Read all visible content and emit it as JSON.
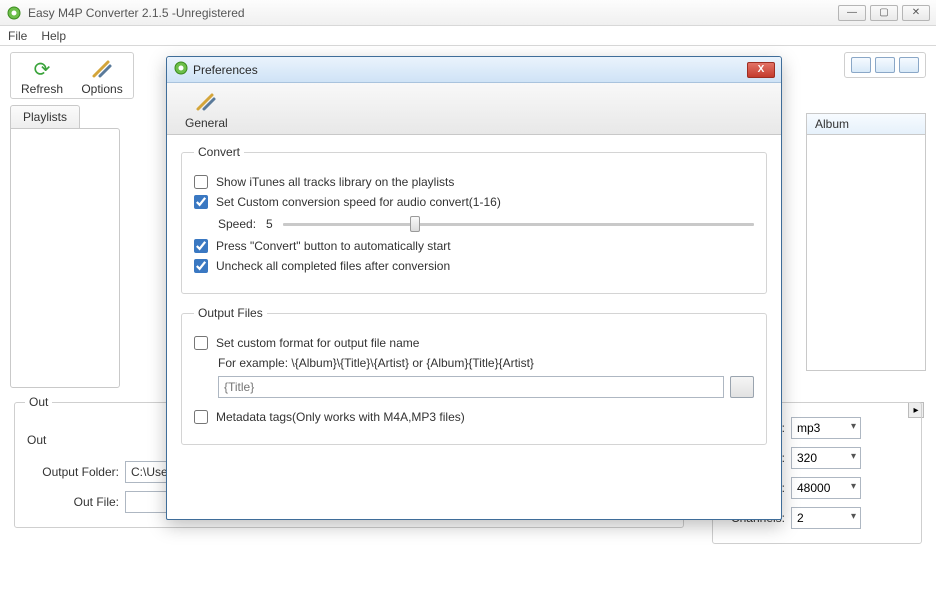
{
  "window": {
    "title": "Easy M4P Converter 2.1.5 -Unregistered"
  },
  "menu": {
    "file": "File",
    "help": "Help"
  },
  "toolbar": {
    "refresh": "Refresh",
    "options": "Options"
  },
  "playlists_tab": "Playlists",
  "list_column_album": "Album",
  "output_section": {
    "legend_prefix": "Out",
    "line2_prefix": "Out",
    "folder_label": "Output Folder:",
    "folder_value": "C:\\Users\\Ontecnia\\Music\\Easy M4P Converter",
    "outfile_label": "Out File:",
    "browse": "..."
  },
  "right_options": {
    "codec_label": "ec:",
    "codec_value": "mp3",
    "bitrate_label": "s):",
    "bitrate_value": "320",
    "samplerate_label_suffix": "(hz):",
    "samplerate_value": "48000",
    "channels_label": "Channels:",
    "channels_value": "2"
  },
  "dialog": {
    "title": "Preferences",
    "tab_general": "General",
    "groups": {
      "convert": {
        "legend": "Convert",
        "show_itunes": "Show iTunes all tracks library on the playlists",
        "custom_speed": "Set Custom conversion speed for audio convert(1-16)",
        "speed_label": "Speed:",
        "speed_value": "5",
        "auto_start": "Press \"Convert\" button to automatically start",
        "uncheck_done": "Uncheck all completed files after conversion"
      },
      "output": {
        "legend": "Output Files",
        "custom_format": "Set custom format for output file name",
        "example": "For example: \\{Album}\\{Title}\\{Artist} or {Album}{Title}{Artist}",
        "format_placeholder": "{Title}",
        "metadata": "Metadata tags(Only works with M4A,MP3 files)"
      }
    }
  }
}
